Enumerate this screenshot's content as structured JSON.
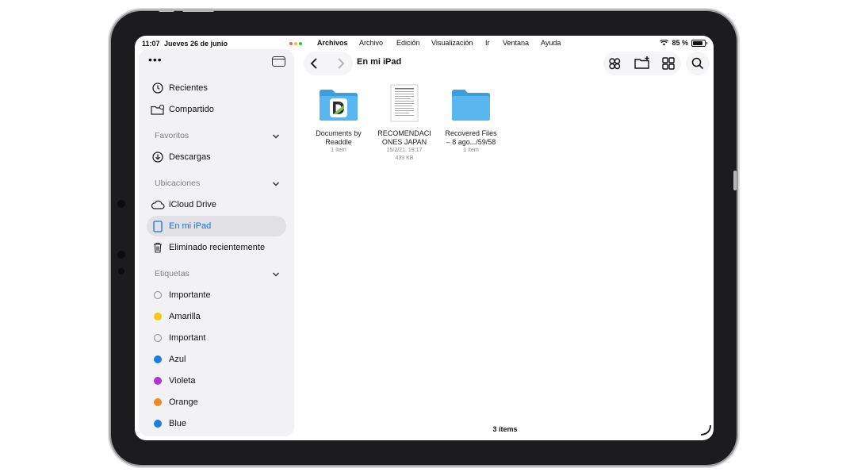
{
  "status_bar": {
    "time": "11:07",
    "date": "Jueves 26 de junio",
    "battery": "85 %",
    "battery_level": 0.85
  },
  "menu_bar": [
    "Archivos",
    "Archivo",
    "Edición",
    "Visualización",
    "Ir",
    "Ventana",
    "Ayuda"
  ],
  "sidebar": {
    "top": [
      {
        "label": "Recientes",
        "icon": "clock-icon"
      },
      {
        "label": "Compartido",
        "icon": "shared-folder-icon"
      }
    ],
    "favoritos": {
      "header": "Favoritos",
      "items": [
        {
          "label": "Descargas",
          "icon": "download-icon"
        }
      ]
    },
    "ubicaciones": {
      "header": "Ubicaciones",
      "items": [
        {
          "label": "iCloud Drive",
          "icon": "cloud-icon"
        },
        {
          "label": "En mi iPad",
          "icon": "ipad-icon",
          "selected": true
        },
        {
          "label": "Eliminado recientemente",
          "icon": "trash-icon"
        }
      ]
    },
    "etiquetas": {
      "header": "Etiquetas",
      "items": [
        {
          "label": "Importante",
          "color": ""
        },
        {
          "label": "Amarilla",
          "color": "#f5c518"
        },
        {
          "label": "Important",
          "color": ""
        },
        {
          "label": "Azul",
          "color": "#1a7fe0"
        },
        {
          "label": "Violeta",
          "color": "#b334d4"
        },
        {
          "label": "Orange",
          "color": "#f08a24"
        },
        {
          "label": "Blue",
          "color": "#1a7fe0"
        }
      ]
    }
  },
  "content": {
    "title": "En mi iPad",
    "files": [
      {
        "name_line1": "Documents by",
        "name_line2": "Readdle",
        "meta1": "1 ítem",
        "meta2": ""
      },
      {
        "name_line1": "RECOMENDACI",
        "name_line2": "ONES JAPAN",
        "meta1": "15/2/21, 19:17",
        "meta2": "439 KB"
      },
      {
        "name_line1": "Recovered Files",
        "name_line2": "– 8 ago.../59/58",
        "meta1": "1 ítem",
        "meta2": ""
      }
    ],
    "items_count": "3 ítems"
  },
  "colors": {
    "accent": "#1472e0",
    "folder": "#5ab6ee",
    "sidebar_bg": "#f2f2f5"
  }
}
